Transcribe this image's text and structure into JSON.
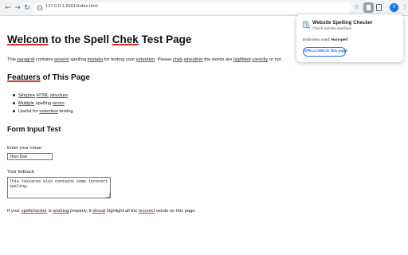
{
  "browser": {
    "url": "127.0.0.1:5501/index.html"
  },
  "popup": {
    "title": "Website Spelling Checker",
    "subtitle": "Check website spellings",
    "dictionary_label": "Dictionary used:",
    "dictionary_value": "Hunspell",
    "button_label": "SPELLCHECK this page"
  },
  "page": {
    "h1": [
      "Welcom",
      " to the ",
      "Spell",
      " ",
      "Chek",
      " Test Page"
    ],
    "intro": [
      "This ",
      "paragraf",
      " contains ",
      "severel",
      " spelling ",
      "mistaks",
      " for testing your ",
      "extention",
      ". Please ",
      "chek",
      " ",
      "wheather",
      " the words are ",
      "highlited",
      " ",
      "corectly",
      " or not."
    ],
    "h2": [
      "Featuers",
      " of This Page"
    ],
    "features": [
      [
        "Simplee",
        " ",
        "HTML",
        " ",
        "structure"
      ],
      [
        "Multiple",
        " spelling ",
        "errors"
      ],
      [
        "Useful for ",
        "extention",
        " testing"
      ]
    ],
    "form_title": "Form Input Test",
    "name_label": "Enter your nmae:",
    "name_value": "Jhon Doe",
    "feedback_label": "Your fedback:",
    "feedback_value": "This textarea also contains some incorect speling.",
    "footer": [
      "If your ",
      "spellchecker",
      " is ",
      "working",
      " properly, it ",
      "shoud",
      " highlight all the ",
      "incorect",
      " words on this page."
    ]
  },
  "colors": {
    "misspelling_underline": "#d93025",
    "accent": "#1a73e8"
  }
}
